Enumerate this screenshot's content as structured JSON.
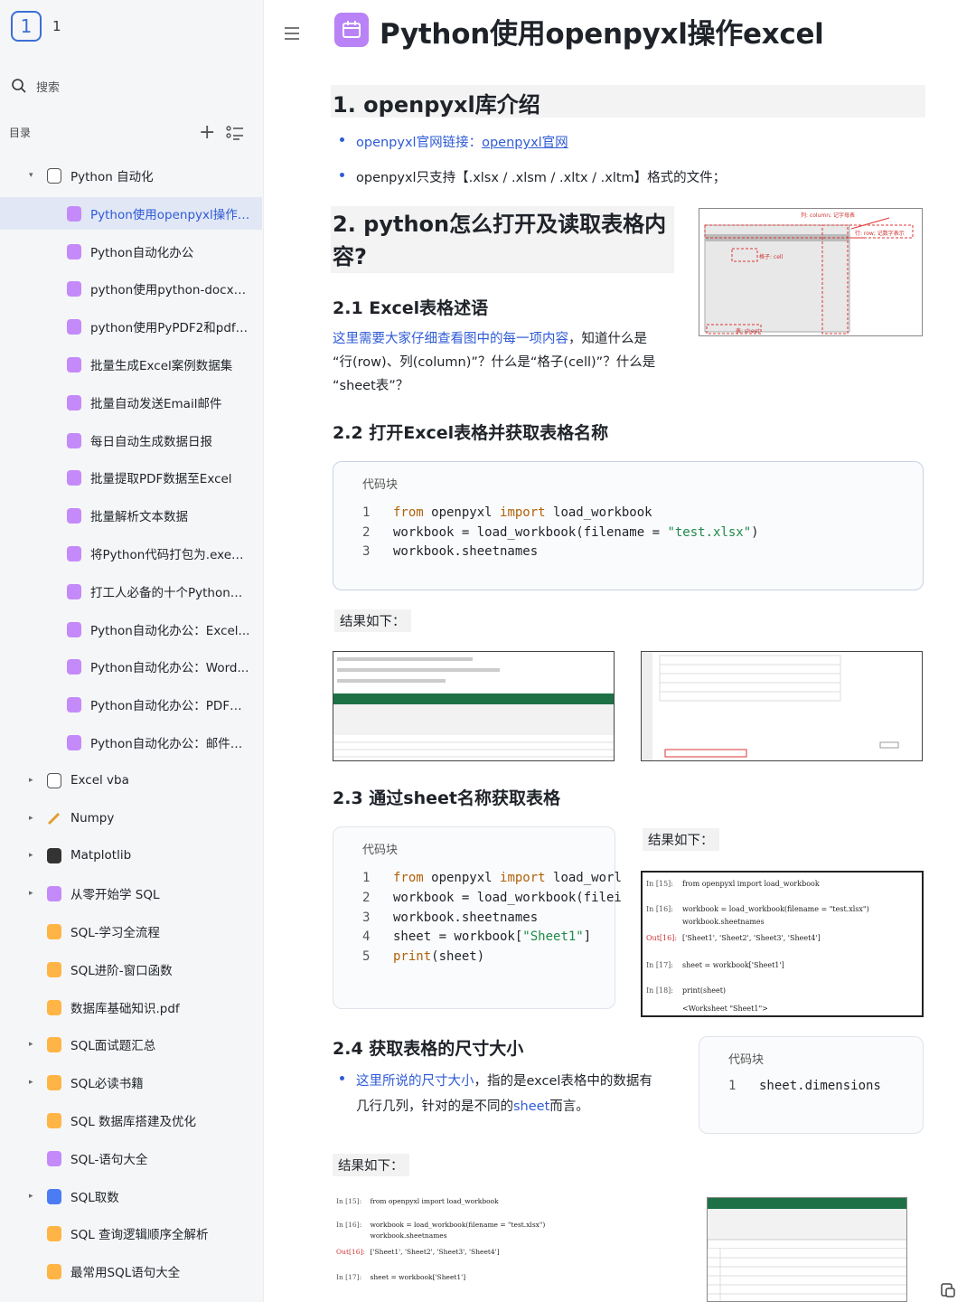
{
  "sidebar": {
    "workspace_badge": "1",
    "workspace_name": "1",
    "search_placeholder": "搜索",
    "toc_label": "目录",
    "items": [
      {
        "label": "Python 自动化",
        "level": 0,
        "caret": "▾",
        "icon": "doc-outline-icon"
      },
      {
        "label": "Python使用openpyxl操作e...",
        "level": 1,
        "icon": "doc-purple-icon",
        "active": true
      },
      {
        "label": "Python自动化办公",
        "level": 1,
        "icon": "doc-purple-icon"
      },
      {
        "label": "python使用python-docx操...",
        "level": 1,
        "icon": "doc-purple-icon"
      },
      {
        "label": "python使用PyPDF2和pdfpl...",
        "level": 1,
        "icon": "doc-purple-icon"
      },
      {
        "label": "批量生成Excel案例数据集",
        "level": 1,
        "icon": "doc-purple-icon"
      },
      {
        "label": "批量自动发送Email邮件",
        "level": 1,
        "icon": "doc-purple-icon"
      },
      {
        "label": "每日自动生成数据日报",
        "level": 1,
        "icon": "doc-purple-icon"
      },
      {
        "label": "批量提取PDF数据至Excel",
        "level": 1,
        "icon": "doc-purple-icon"
      },
      {
        "label": "批量解析文本数据",
        "level": 1,
        "icon": "doc-purple-icon"
      },
      {
        "label": "将Python代码打包为.exe程序",
        "level": 1,
        "icon": "doc-purple-icon"
      },
      {
        "label": "打工人必备的十个Python自...",
        "level": 1,
        "icon": "doc-purple-icon"
      },
      {
        "label": "Python自动化办公：Excel...",
        "level": 1,
        "icon": "doc-purple-icon"
      },
      {
        "label": "Python自动化办公：Word...",
        "level": 1,
        "icon": "doc-purple-icon"
      },
      {
        "label": "Python自动化办公：PDF自...",
        "level": 1,
        "icon": "doc-purple-icon"
      },
      {
        "label": "Python自动化办公：邮件自...",
        "level": 1,
        "icon": "doc-purple-icon"
      },
      {
        "label": "Excel vba",
        "level": 0,
        "caret": "▸",
        "icon": "doc-outline-icon"
      },
      {
        "label": "Numpy",
        "level": 0,
        "caret": "▸",
        "icon": "pencil-icon"
      },
      {
        "label": "Matplotlib",
        "level": 0,
        "caret": "▸",
        "icon": "image-icon"
      },
      {
        "label": "从零开始学 SQL",
        "level": 0,
        "caret": "▸",
        "icon": "doc-purple-icon"
      },
      {
        "label": "SQL-学习全流程",
        "level": 0,
        "icon": "doc-orange-icon"
      },
      {
        "label": "SQL进阶-窗口函数",
        "level": 0,
        "icon": "doc-orange-icon"
      },
      {
        "label": "数据库基础知识.pdf",
        "level": 0,
        "icon": "doc-orange-icon"
      },
      {
        "label": "SQL面试题汇总",
        "level": 0,
        "caret": "▸",
        "icon": "doc-orange-icon"
      },
      {
        "label": "SQL必读书籍",
        "level": 0,
        "caret": "▸",
        "icon": "doc-orange-icon"
      },
      {
        "label": "SQL 数据库搭建及优化",
        "level": 0,
        "icon": "doc-orange-icon"
      },
      {
        "label": "SQL-语句大全",
        "level": 0,
        "icon": "doc-purple-icon"
      },
      {
        "label": "SQL取数",
        "level": 0,
        "caret": "▸",
        "icon": "doc-blue-icon"
      },
      {
        "label": "SQL 查询逻辑顺序全解析",
        "level": 0,
        "icon": "doc-orange-icon"
      },
      {
        "label": "最常用SQL语句大全",
        "level": 0,
        "icon": "doc-orange-icon"
      }
    ]
  },
  "doc": {
    "title": "Python使用openpyxl操作excel",
    "h1_1": "1. openpyxl库介绍",
    "b1_prefix": "openpyxl官网链接：",
    "b1_link": "openpyxl官网",
    "b2": "openpyxl只支持【.xlsx / .xlsm / .xltx / .xltm】格式的文件；",
    "h1_2_line1": "2. python怎么打开及读取表格内",
    "h1_2_line2": "容?",
    "h2_1": "2.1 Excel表格述语",
    "p1_line1_blue": "这里需要大家仔细查看图中的每一项内容",
    "p1_line1_rest": "，知道什么是",
    "p1_line2": "“行(row)、列(column)”？什么是“格子(cell)”？什么是",
    "p1_line3": "“sheet表”？",
    "h2_2": "2.2 打开Excel表格并获取表格名称",
    "code_caption": "代码块",
    "code1": [
      {
        "n": "1",
        "parts": [
          [
            "kw",
            "from"
          ],
          [
            "t",
            " openpyxl "
          ],
          [
            "kw",
            "import"
          ],
          [
            "t",
            " load_workbook"
          ]
        ]
      },
      {
        "n": "2",
        "parts": [
          [
            "t",
            "workbook = load_workbook(filename = "
          ],
          [
            "str",
            "\"test.xlsx\""
          ],
          [
            "t",
            ")"
          ]
        ]
      },
      {
        "n": "3",
        "parts": [
          [
            "t",
            "workbook.sheetnames"
          ]
        ]
      }
    ],
    "result_label": "结果如下：",
    "h2_3": "2.3 通过sheet名称获取表格",
    "code2": [
      {
        "n": "1",
        "parts": [
          [
            "kw",
            "from"
          ],
          [
            "t",
            " openpyxl "
          ],
          [
            "kw",
            "import"
          ],
          [
            "t",
            " load_worl"
          ]
        ]
      },
      {
        "n": "2",
        "parts": [
          [
            "t",
            "workbook = load_workbook(filei"
          ]
        ]
      },
      {
        "n": "3",
        "parts": [
          [
            "t",
            "workbook.sheetnames"
          ]
        ]
      },
      {
        "n": "4",
        "parts": [
          [
            "t",
            "sheet = workbook["
          ],
          [
            "str",
            "\"Sheet1\""
          ],
          [
            "t",
            "]"
          ]
        ]
      },
      {
        "n": "5",
        "parts": [
          [
            "kw",
            "print"
          ],
          [
            "t",
            "(sheet)"
          ]
        ]
      }
    ],
    "h2_4": "2.4 获取表格的尺寸大小",
    "p2_blue": "这里所说的尺寸大小",
    "p2_rest": "，指的是excel表格中的数据有",
    "p2_line2_a": "几行几列，针对的是不同的",
    "p2_line2_blue": "sheet",
    "p2_line2_b": "而言。",
    "code3": [
      {
        "n": "1",
        "parts": [
          [
            "t",
            "sheet.dimensions"
          ]
        ]
      }
    ],
    "shot_jupyter": [
      {
        "prompt": "In  [15]:",
        "code": "from openpyxl import load_workbook"
      },
      {
        "prompt": "In  [16]:",
        "code": "workbook = load_workbook(filename = \"test.xlsx\")"
      },
      {
        "prompt": "",
        "code": "workbook.sheetnames"
      },
      {
        "prompt": "Out[16]:",
        "code": "['Sheet1', 'Sheet2', 'Sheet3', 'Sheet4']"
      },
      {
        "prompt": "In  [17]:",
        "code": "sheet = workbook['Sheet1']"
      },
      {
        "prompt": "In  [18]:",
        "code": "print(sheet)"
      },
      {
        "prompt": "",
        "code": "<Worksheet \"Sheet1\">"
      }
    ],
    "shot_diagram_col": "列: column; 记字母表",
    "shot_diagram_row": "行: row; 记数字表示",
    "shot_diagram_cell": "格子: cell",
    "shot_diagram_sheet": "表: sheet"
  }
}
